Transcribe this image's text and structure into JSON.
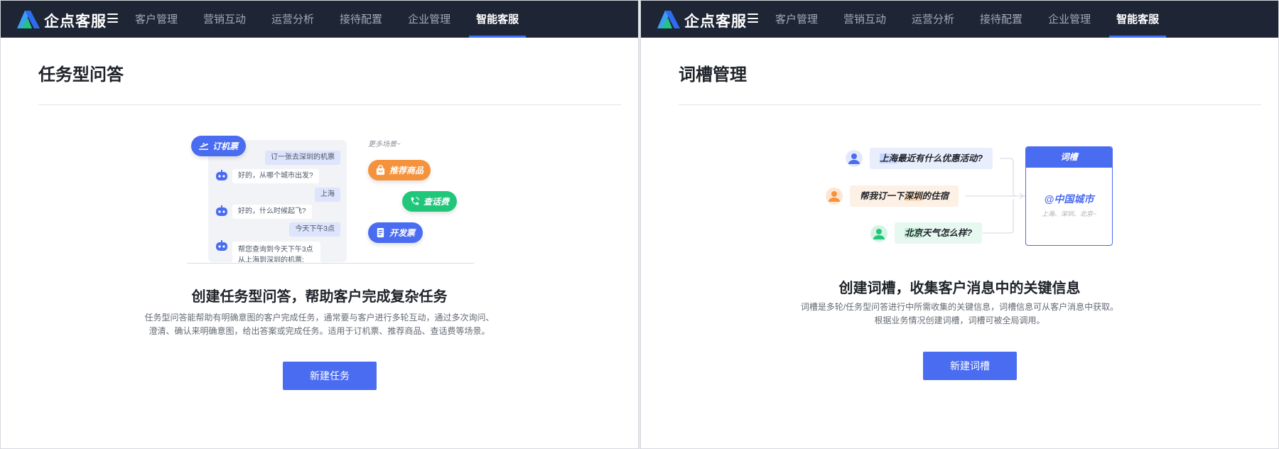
{
  "app": {
    "brand": "企点客服",
    "nav": [
      "客户管理",
      "营销互动",
      "运营分析",
      "接待配置",
      "企业管理",
      "智能客服"
    ],
    "active_nav": "智能客服",
    "colors": {
      "topbar": "#1e2535",
      "accent": "#4a6cf1",
      "orange": "#f5933d",
      "green": "#20c77b"
    }
  },
  "left": {
    "title": "任务型问答",
    "chat": {
      "bubbles": [
        {
          "role": "user",
          "text": "订一张去深圳的机票"
        },
        {
          "role": "bot",
          "text": "好的，从哪个城市出发?"
        },
        {
          "role": "user",
          "text": "上海"
        },
        {
          "role": "bot",
          "text": "好的，什么时候起飞?"
        },
        {
          "role": "user",
          "text": "今天下午3点"
        },
        {
          "role": "bot",
          "text": "帮您查询到今天下午3点从上海到深圳的机票:"
        }
      ],
      "task_pill": "订机票",
      "more_label": "更多场景~",
      "scene_pills": [
        "推荐商品",
        "查话费",
        "开发票"
      ]
    },
    "headline": "创建任务型问答，帮助客户完成复杂任务",
    "desc_lines": [
      "任务型问答能帮助有明确意图的客户完成任务，通常要与客户进行多轮互动，通过多次询问、",
      "澄清、确认来明确意图，给出答案或完成任务。适用于订机票、推荐商品、查话费等场景。"
    ],
    "button": "新建任务"
  },
  "right": {
    "title": "词槽管理",
    "questions": [
      {
        "hl": "上海",
        "rest": "最近有什么优惠活动?"
      },
      {
        "pre": "帮我订一下",
        "hl": "深圳",
        "rest": "的住宿"
      },
      {
        "hl": "北京",
        "rest": "天气怎么样?"
      }
    ],
    "slot": {
      "header": "词槽",
      "main": "@中国城市",
      "sub": "上海、深圳、北京~"
    },
    "headline": "创建词槽，收集客户消息中的关键信息",
    "desc_lines": [
      "词槽是多轮/任务型问答进行中所需收集的关键信息，词槽信息可从客户消息中获取。",
      "根据业务情况创建词槽，词槽可被全局调用。"
    ],
    "button": "新建词槽"
  }
}
